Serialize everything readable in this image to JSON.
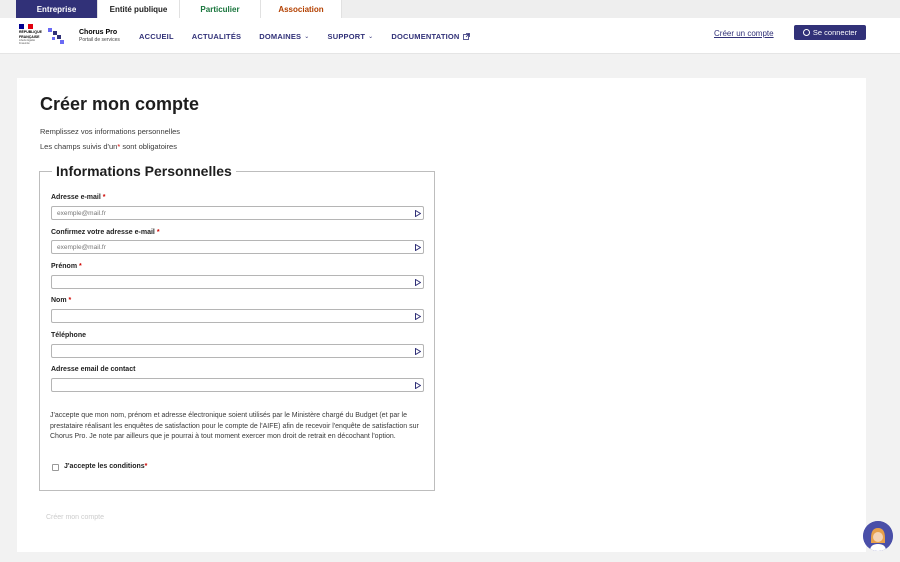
{
  "audience_tabs": [
    {
      "label": "Entreprise",
      "color": "#ffffff",
      "active": true
    },
    {
      "label": "Entité publique",
      "color": "#1e1e1e",
      "active": false
    },
    {
      "label": "Particulier",
      "color": "#18753c",
      "active": false
    },
    {
      "label": "Association",
      "color": "#b34000",
      "active": false
    }
  ],
  "header": {
    "republic_lines": [
      "RÉPUBLIQUE",
      "FRANÇAISE"
    ],
    "motto": "Liberté Égalité Fraternité",
    "brand_name": "Chorus Pro",
    "brand_sub": "Portail de services",
    "nav": [
      {
        "label": "ACCUEIL",
        "icon": ""
      },
      {
        "label": "ACTUALITÉS",
        "icon": ""
      },
      {
        "label": "DOMAINES",
        "icon": "chevron-down-icon"
      },
      {
        "label": "SUPPORT",
        "icon": "chevron-down-icon"
      },
      {
        "label": "DOCUMENTATION",
        "icon": "external-link-icon"
      }
    ],
    "create_account_link": "Créer un compte",
    "login_button": "Se connecter"
  },
  "page": {
    "title": "Créer mon compte",
    "intro_line1": "Remplissez vos informations personnelles",
    "intro_line2_before": "Les champs suivis d'un",
    "intro_line2_star": "*",
    "intro_line2_after": "sont obligatoires"
  },
  "form": {
    "legend": "Informations Personnelles",
    "fields": [
      {
        "label": "Adresse e-mail",
        "required": "*",
        "placeholder": "exemple@mail.fr",
        "value": ""
      },
      {
        "label": "Confirmez votre adresse e-mail",
        "required": "*",
        "placeholder": "exemple@mail.fr",
        "value": ""
      },
      {
        "label": "Prénom",
        "required": "*",
        "placeholder": "",
        "value": ""
      },
      {
        "label": "Nom",
        "required": "*",
        "placeholder": "",
        "value": ""
      },
      {
        "label": "Téléphone",
        "required": "",
        "placeholder": "",
        "value": ""
      },
      {
        "label": "Adresse email de contact",
        "required": "",
        "placeholder": "",
        "value": ""
      }
    ],
    "consent_text": "J'accepte que mon nom, prénom et adresse électronique soient utilisés par le Ministère chargé du Budget (et par le prestataire réalisant les enquêtes de satisfaction pour le compte de l'AIFE) afin de recevoir l'enquête de satisfaction sur Chorus Pro. Je note par ailleurs que je pourrai à tout moment exercer mon droit de retrait en décochant l'option.",
    "checkbox_label": "J'accepte les conditions",
    "checkbox_required": "*",
    "checkbox_checked": false,
    "submit_label": "Créer mon compte"
  },
  "colors": {
    "primary": "#313178",
    "required": "#ce0500",
    "particulier": "#18753c",
    "association": "#b34000"
  },
  "assistant": {
    "icon": "assistant-avatar-icon"
  }
}
